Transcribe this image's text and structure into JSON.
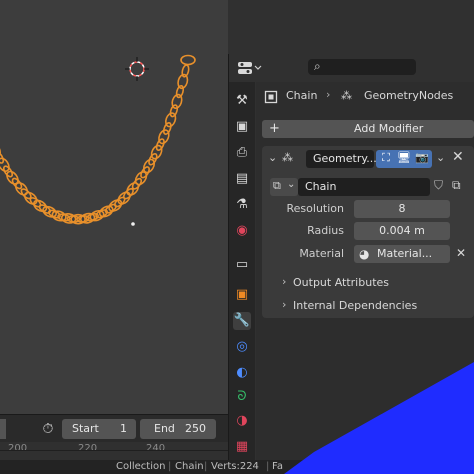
{
  "properties": {
    "breadcrumb": {
      "object": "Chain",
      "modifier": "GeometryNodes"
    },
    "add_modifier": "Add Modifier",
    "modifier": {
      "name": "Geometry...",
      "node_group": "Chain",
      "fields": [
        {
          "label": "Resolution",
          "value": "8"
        },
        {
          "label": "Radius",
          "value": "0.004 m"
        },
        {
          "label": "Material",
          "value": "Material..."
        }
      ],
      "sections": [
        "Output Attributes",
        "Internal Dependencies"
      ]
    }
  },
  "timeline": {
    "start_label": "Start",
    "start_value": "1",
    "end_label": "End",
    "end_value": "250",
    "frames": [
      "200",
      "220",
      "240"
    ]
  },
  "statusbar": {
    "items": [
      "Collection",
      "Chain",
      "Verts:224",
      "Fa"
    ]
  },
  "colors": {
    "accent_orange": "#e8902b",
    "selection_blue": "#4772b3",
    "corner_blue": "#1f2cff"
  }
}
